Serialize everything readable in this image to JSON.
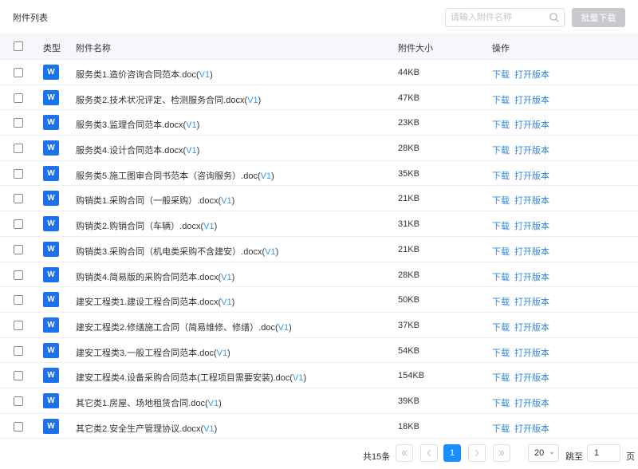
{
  "header": {
    "title": "附件列表",
    "search_placeholder": "请输入附件名称",
    "batch_download_label": "批量下载"
  },
  "table": {
    "columns": {
      "type": "类型",
      "name": "附件名称",
      "size": "附件大小",
      "actions": "操作"
    },
    "action_download": "下载",
    "action_open": "打开版本",
    "rows": [
      {
        "type": "W",
        "name": "服务类1.造价咨询合同范本.doc",
        "version": "V1",
        "size": "44KB"
      },
      {
        "type": "W",
        "name": "服务类2.技术状况评定、检测服务合同.docx",
        "version": "V1",
        "size": "47KB"
      },
      {
        "type": "W",
        "name": "服务类3.监理合同范本.docx",
        "version": "V1",
        "size": "23KB"
      },
      {
        "type": "W",
        "name": "服务类4.设计合同范本.docx",
        "version": "V1",
        "size": "28KB"
      },
      {
        "type": "W",
        "name": "服务类5.施工图审合同书范本（咨询服务）.doc",
        "version": "V1",
        "size": "35KB"
      },
      {
        "type": "W",
        "name": "购销类1.采购合同（一般采购）.docx",
        "version": "V1",
        "size": "21KB"
      },
      {
        "type": "W",
        "name": "购销类2.购销合同（车辆）.docx",
        "version": "V1",
        "size": "31KB"
      },
      {
        "type": "W",
        "name": "购销类3.采购合同（机电类采购不含建安）.docx",
        "version": "V1",
        "size": "21KB"
      },
      {
        "type": "W",
        "name": "购销类4.简易版的采购合同范本.docx",
        "version": "V1",
        "size": "28KB"
      },
      {
        "type": "W",
        "name": "建安工程类1.建设工程合同范本.docx",
        "version": "V1",
        "size": "50KB"
      },
      {
        "type": "W",
        "name": "建安工程类2.修缮施工合同（简易维修、修缮）.doc",
        "version": "V1",
        "size": "37KB"
      },
      {
        "type": "W",
        "name": "建安工程类3.一般工程合同范本.doc",
        "version": "V1",
        "size": "54KB"
      },
      {
        "type": "W",
        "name": "建安工程类4.设备采购合同范本(工程项目需要安装).doc",
        "version": "V1",
        "size": "154KB"
      },
      {
        "type": "W",
        "name": "其它类1.房屋、场地租赁合同.doc",
        "version": "V1",
        "size": "39KB"
      },
      {
        "type": "W",
        "name": "其它类2.安全生产管理协议.docx",
        "version": "V1",
        "size": "18KB"
      }
    ]
  },
  "pagination": {
    "total_label": "共15条",
    "current_page": "1",
    "page_size": "20",
    "jump_label": "跳至",
    "jump_value": "1",
    "page_suffix": "页"
  },
  "colors": {
    "primary": "#1890ff",
    "link": "#2f88e0",
    "doc_icon": "#1a73e8",
    "disabled_button": "#c8c9cc"
  },
  "icons": {
    "search": "search-icon",
    "first": "double-chevron-left-icon",
    "prev": "chevron-left-icon",
    "next": "chevron-right-icon",
    "last": "double-chevron-right-icon",
    "select": "chevron-down-icon",
    "file": "word-doc-icon"
  }
}
